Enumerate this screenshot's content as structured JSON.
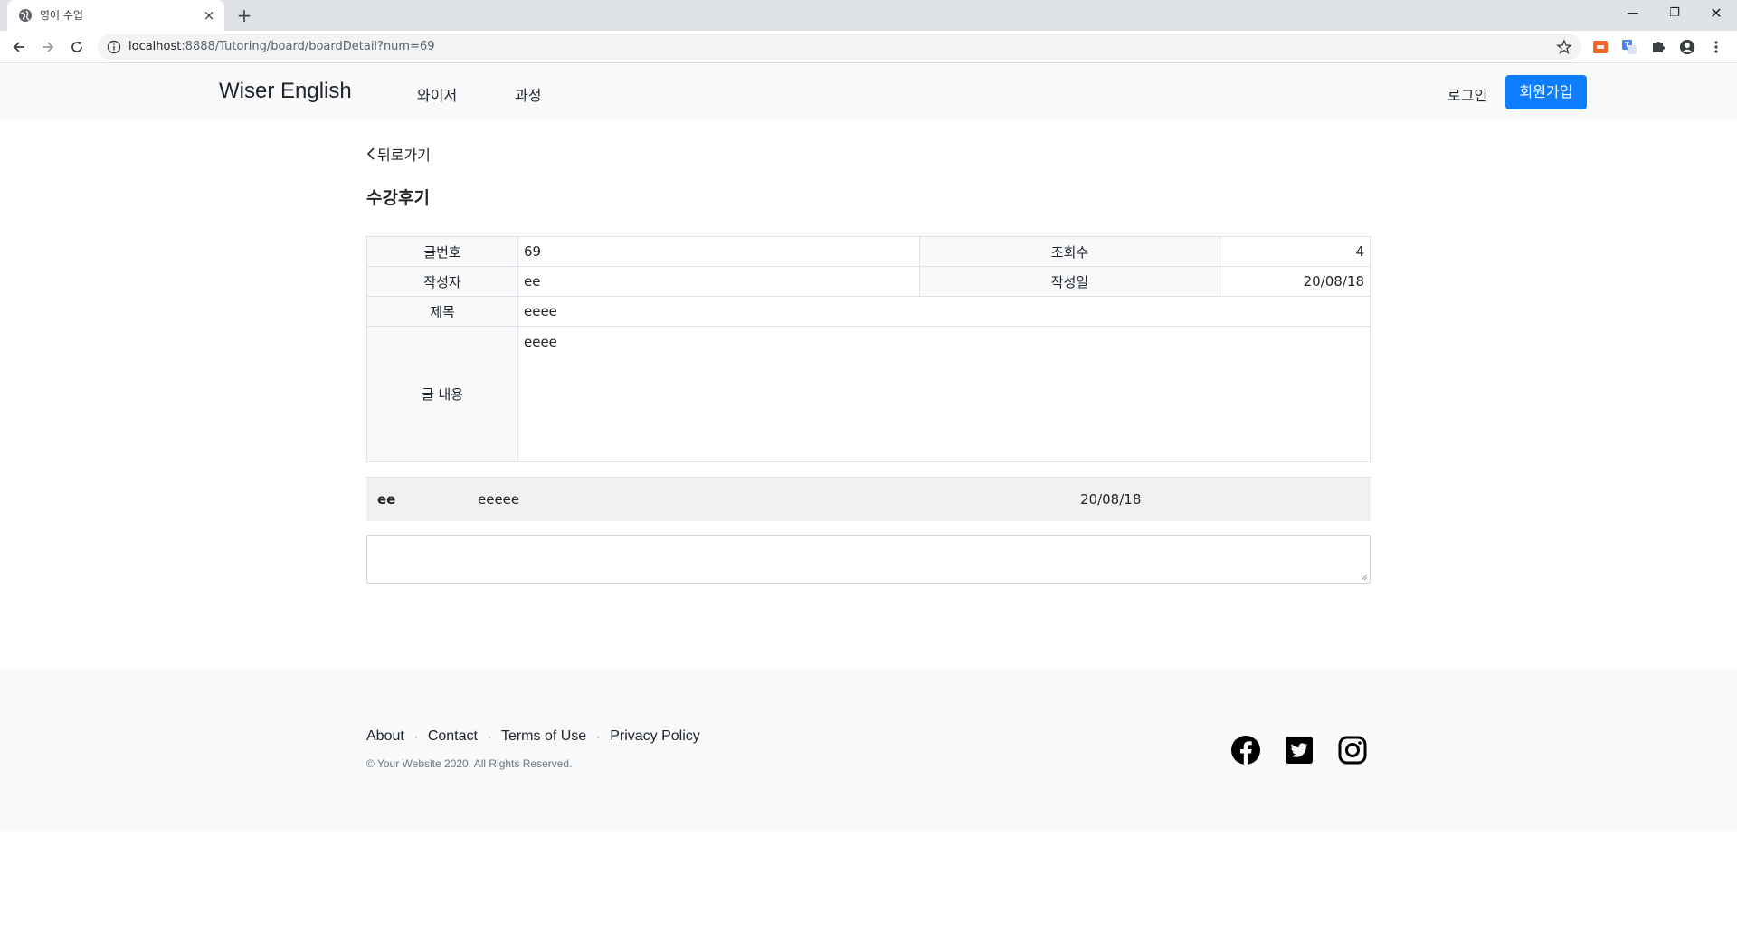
{
  "browser": {
    "tab_title": "영어 수업",
    "tab_close": "×",
    "new_tab": "+",
    "url_host": "localhost",
    "url_path": ":8888/Tutoring/board/boardDetail?num=69",
    "window_min": "—",
    "window_max": "❐",
    "window_close": "✕"
  },
  "navbar": {
    "brand": "Wiser English",
    "links": [
      "와이저",
      "과정"
    ],
    "login": "로그인",
    "signup": "회원가입",
    "accent_color": "#0d7cfd"
  },
  "page": {
    "back": "뒤로가기",
    "title": "수강후기"
  },
  "post": {
    "labels": {
      "number": "글번호",
      "views": "조회수",
      "author": "작성자",
      "date": "작성일",
      "subject": "제목",
      "content": "글 내용"
    },
    "number": "69",
    "views": "4",
    "author": "ee",
    "date": "20/08/18",
    "subject": "eeee",
    "content": "eeee"
  },
  "comments": [
    {
      "author": "ee",
      "text": "eeeee",
      "date": "20/08/18"
    }
  ],
  "comment_input": {
    "value": ""
  },
  "footer": {
    "links": [
      "About",
      "Contact",
      "Terms of Use",
      "Privacy Policy"
    ],
    "separator": "·",
    "copyright": "© Your Website 2020. All Rights Reserved.",
    "social": [
      "facebook-icon",
      "twitter-icon",
      "instagram-icon"
    ]
  }
}
